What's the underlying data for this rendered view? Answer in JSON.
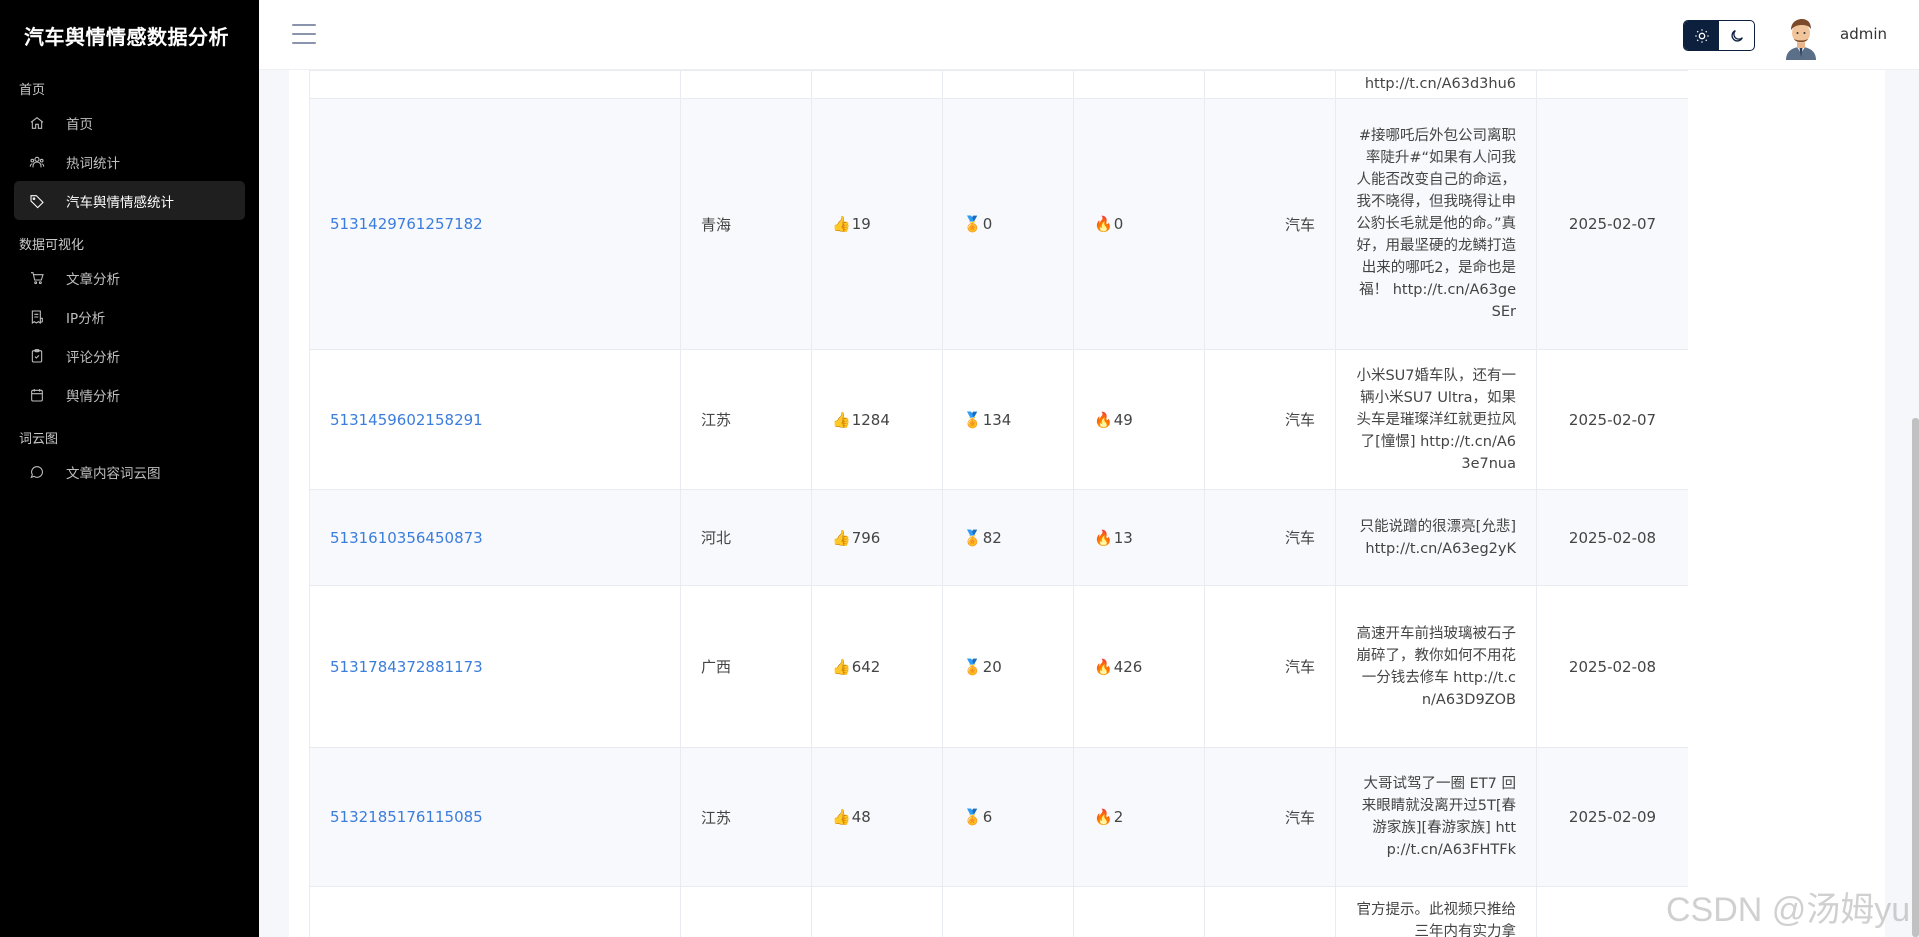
{
  "app": {
    "title": "汽车舆情情感数据分析"
  },
  "sidebar": {
    "sections": [
      {
        "title": "首页",
        "items": [
          {
            "label": "首页",
            "icon": "home-icon"
          },
          {
            "label": "热词统计",
            "icon": "users-icon"
          },
          {
            "label": "汽车舆情情感统计",
            "icon": "tag-icon",
            "active": true
          }
        ]
      },
      {
        "title": "数据可视化",
        "items": [
          {
            "label": "文章分析",
            "icon": "cart-icon"
          },
          {
            "label": "IP分析",
            "icon": "receipt-icon"
          },
          {
            "label": "评论分析",
            "icon": "clipboard-icon"
          },
          {
            "label": "舆情分析",
            "icon": "calendar-icon"
          }
        ]
      },
      {
        "title": "词云图",
        "items": [
          {
            "label": "文章内容词云图",
            "icon": "message-icon"
          }
        ]
      }
    ]
  },
  "header": {
    "username": "admin"
  },
  "table": {
    "partial_top": {
      "content": "http://t.cn/A63d3hu6"
    },
    "rows": [
      {
        "id": "5131429761257182",
        "region": "青海",
        "likes": "19",
        "comments": "0",
        "reposts": "0",
        "type": "汽车",
        "content": "#接哪吒后外包公司离职率陡升#“如果有人问我人能否改变自己的命运，我不晓得，但我晓得让申公豹长毛就是他的命。”真好，用最坚硬的龙鳞打造出来的哪吒2，是命也是福！ http://t.cn/A63geSEr",
        "date": "2025-02-07"
      },
      {
        "id": "5131459602158291",
        "region": "江苏",
        "likes": "1284",
        "comments": "134",
        "reposts": "49",
        "type": "汽车",
        "content": "小米SU7婚车队，还有一辆小米SU7 Ultra，如果头车是璀璨洋红就更拉风了[憧憬] http://t.cn/A63e7nua",
        "date": "2025-02-07"
      },
      {
        "id": "5131610356450873",
        "region": "河北",
        "likes": "796",
        "comments": "82",
        "reposts": "13",
        "type": "汽车",
        "content": "只能说蹭的很漂亮[允悲] http://t.cn/A63eg2yK",
        "date": "2025-02-08"
      },
      {
        "id": "5131784372881173",
        "region": "广西",
        "likes": "642",
        "comments": "20",
        "reposts": "426",
        "type": "汽车",
        "content": "高速开车前挡玻璃被石子崩碎了，教你如何不用花一分钱去修车 http://t.cn/A63D9ZOB",
        "date": "2025-02-08"
      },
      {
        "id": "5132185176115085",
        "region": "江苏",
        "likes": "48",
        "comments": "6",
        "reposts": "2",
        "type": "汽车",
        "content": "大哥试驾了一圈 ET7 回来眼睛就没离开过5T[春游家族][春游家族] http://t.cn/A63FHTFk",
        "date": "2025-02-09"
      }
    ],
    "partial_bottom": {
      "content": "官方提示。此视频只推给三年内有实力拿"
    }
  },
  "watermark": "CSDN @汤姆yu"
}
